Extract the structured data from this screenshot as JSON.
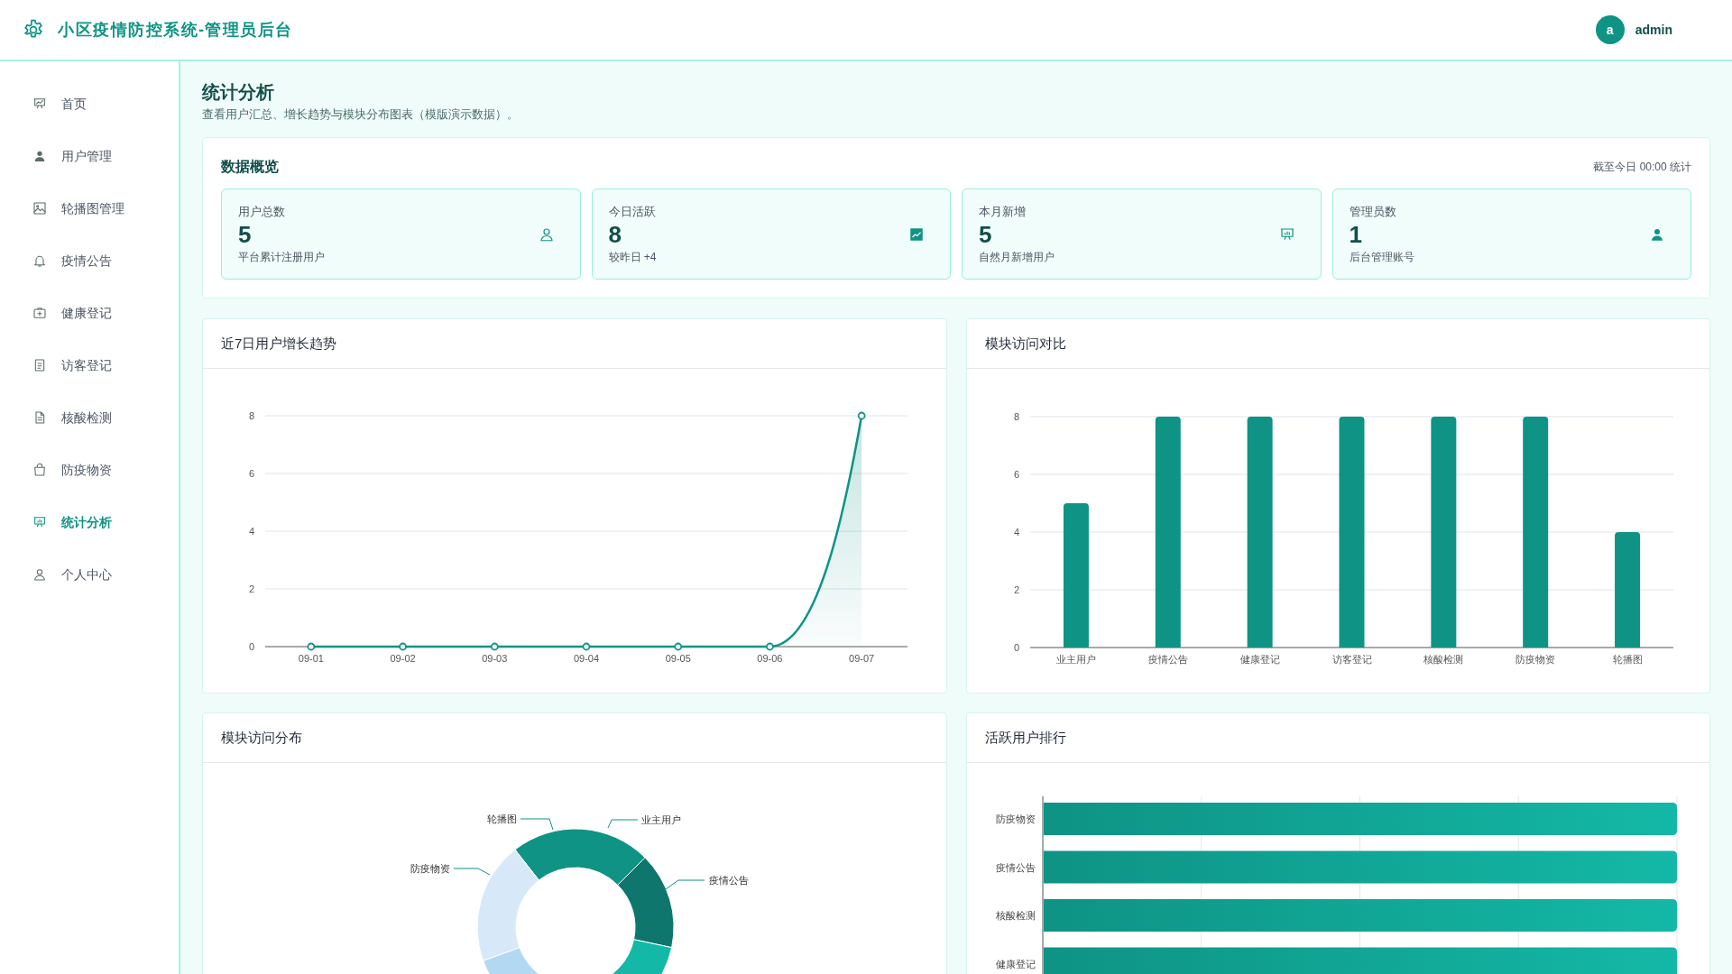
{
  "header": {
    "title": "小区疫情防控系统-管理员后台",
    "user": {
      "avatar": "a",
      "name": "admin"
    }
  },
  "sidebar": {
    "items": [
      {
        "label": "首页",
        "selected": false
      },
      {
        "label": "用户管理",
        "selected": false
      },
      {
        "label": "轮播图管理",
        "selected": false
      },
      {
        "label": "疫情公告",
        "selected": false
      },
      {
        "label": "健康登记",
        "selected": false
      },
      {
        "label": "访客登记",
        "selected": false
      },
      {
        "label": "核酸检测",
        "selected": false
      },
      {
        "label": "防疫物资",
        "selected": false
      },
      {
        "label": "统计分析",
        "selected": true
      },
      {
        "label": "个人中心",
        "selected": false
      }
    ]
  },
  "page": {
    "title": "统计分析",
    "subtitle": "查看用户汇总、增长趋势与模块分布图表（模版演示数据）。"
  },
  "overview": {
    "title": "数据概览",
    "note": "截至今日 00:00 统计",
    "stats": [
      {
        "label": "用户总数",
        "value": "5",
        "caption": "平台累计注册用户"
      },
      {
        "label": "今日活跃",
        "value": "8",
        "caption": "较昨日 +4"
      },
      {
        "label": "本月新增",
        "value": "5",
        "caption": "自然月新增用户"
      },
      {
        "label": "管理员数",
        "value": "1",
        "caption": "后台管理账号"
      }
    ]
  },
  "growth": {
    "title": "近7日用户增长趋势",
    "chart_data": {
      "type": "line",
      "categories": [
        "09-01",
        "09-02",
        "09-03",
        "09-04",
        "09-05",
        "09-06",
        "09-07"
      ],
      "series": [
        {
          "color": "#0e9384",
          "marker": true,
          "values": [
            0,
            0,
            0,
            0,
            0,
            0,
            8
          ]
        }
      ],
      "ylim": [
        0,
        8
      ],
      "yticks": [
        0,
        2,
        4,
        6,
        8
      ],
      "grid": true
    }
  },
  "module_compare": {
    "title": "模块访问对比",
    "chart_data": {
      "type": "bar",
      "categories": [
        "业主用户",
        "疫情公告",
        "健康登记",
        "访客登记",
        "核酸检测",
        "防疫物资",
        "轮播图"
      ],
      "series": [
        {
          "color": "#0e9384",
          "values": [
            5,
            8,
            8,
            8,
            8,
            8,
            4
          ]
        }
      ],
      "ylim": [
        0,
        8
      ],
      "yticks": [
        0,
        2,
        4,
        6,
        8
      ],
      "grid": true
    }
  },
  "distribution": {
    "title": "模块访问分布",
    "labels": [
      "轮播图",
      "业主用户",
      "防疫物资",
      "疫情公告"
    ]
  },
  "ranking": {
    "title": "活跃用户排行",
    "rows": [
      {
        "label": "防疫物资"
      },
      {
        "label": "疫情公告"
      },
      {
        "label": "核酸检测"
      },
      {
        "label": "健康登记"
      }
    ]
  }
}
